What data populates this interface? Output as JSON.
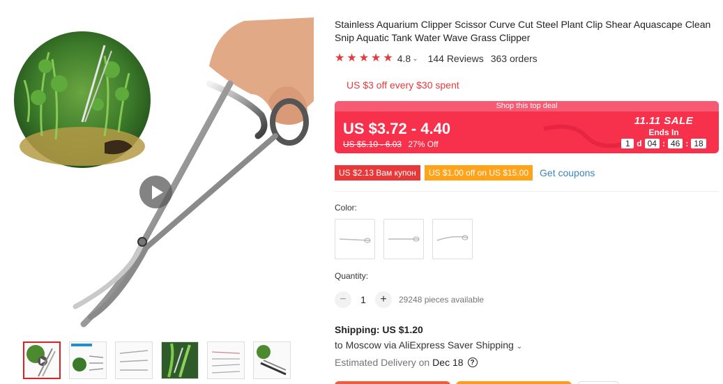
{
  "product": {
    "title": "Stainless Aquarium Clipper Scissor Curve Cut Steel Plant Clip Shear Aquascape Clean Snip Aquatic Tank Water Wave Grass Clipper",
    "rating": "4.8",
    "stars": 5,
    "reviews": "144 Reviews",
    "orders": "363 orders"
  },
  "promo": {
    "store_discount": "US $3 off every $30 spent"
  },
  "deal": {
    "banner": "Shop this top deal",
    "price_range": "US $3.72 - 4.40",
    "old_price": "US $5.10 - 6.03",
    "discount": "27% Off",
    "sale_title": "11.11 SALE",
    "ends_in": "Ends In",
    "timer": {
      "days": "1",
      "days_unit": "d",
      "hours": "04",
      "minutes": "46",
      "seconds": "18"
    },
    "colors": {
      "box": "#f7304b",
      "banner": "#f75a73"
    }
  },
  "coupons": {
    "items": [
      "US $2.13 Вам купон",
      "US $1.00 off on US $15.00"
    ],
    "get_link": "Get coupons"
  },
  "options": {
    "color_label": "Color:",
    "quantity_label": "Quantity:",
    "quantity": "1",
    "available": "29248 pieces available"
  },
  "shipping": {
    "title": "Shipping: US $1.20",
    "route": "to Moscow via AliExpress Saver Shipping",
    "delivery_label": "Estimated Delivery on",
    "delivery_date": "Dec 18"
  },
  "icons": [
    "play-icon",
    "star-icon",
    "chevron-down-icon",
    "minus-icon",
    "plus-icon",
    "help-icon"
  ]
}
